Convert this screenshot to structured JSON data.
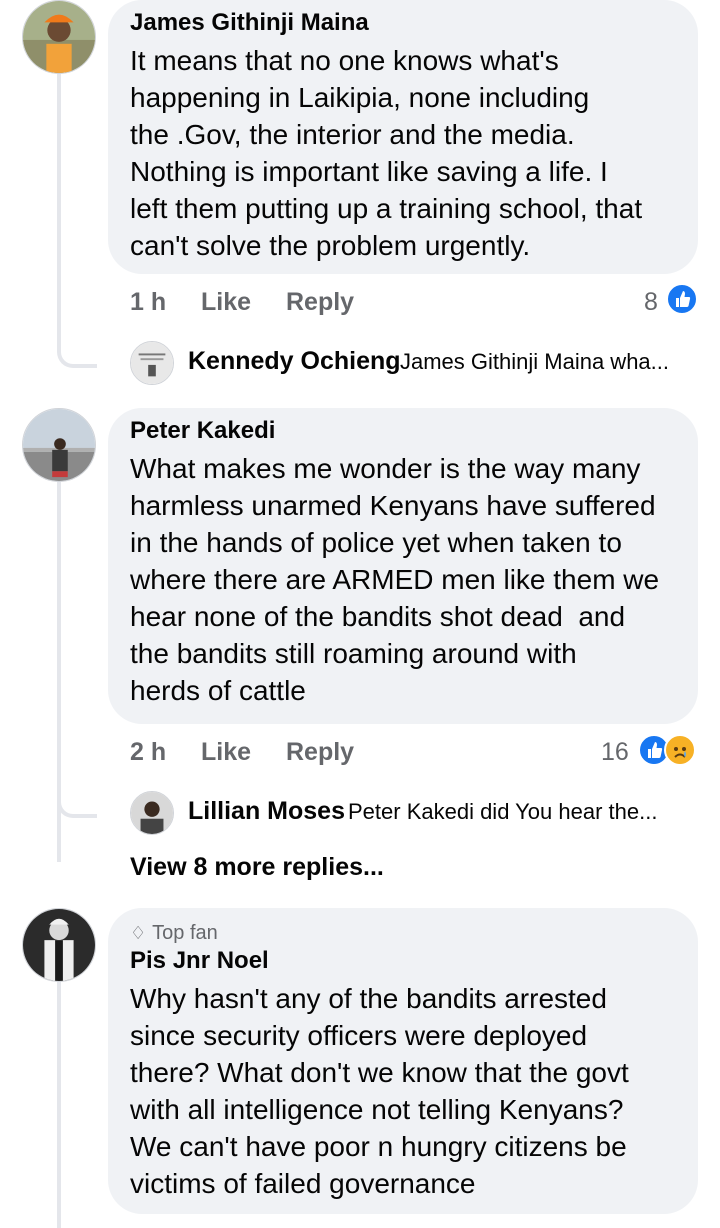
{
  "comments": [
    {
      "author": "James Githinji Maina",
      "text": "It means that no one knows what's\nhappening in Laikipia, none including\nthe .Gov, the interior and the media.\nNothing is important like saving a life. I\nleft them putting up a training school, that\ncan't solve the problem urgently.",
      "time": "1 h",
      "like_label": "Like",
      "reply_label": "Reply",
      "reaction_count": "8",
      "reply_preview": {
        "author": "Kennedy Ochieng",
        "snippet": "James Githinji Maina wha..."
      }
    },
    {
      "author": "Peter Kakedi",
      "text": "What makes me wonder is the way many\nharmless unarmed Kenyans have suffered\nin the hands of police yet when taken to\nwhere there are ARMED men like them we\nhear none of the bandits shot dead  and\nthe bandits still roaming around with\nherds of cattle",
      "time": "2 h",
      "like_label": "Like",
      "reply_label": "Reply",
      "reaction_count": "16",
      "reply_preview": {
        "author": "Lillian Moses",
        "snippet": "Peter Kakedi did You hear the..."
      },
      "more_replies": "View 8 more replies..."
    },
    {
      "badge": "Top fan",
      "author": "Pis Jnr Noel",
      "text": "Why hasn't any of the bandits arrested\nsince security officers were deployed\nthere? What don't we know that the govt\nwith all intelligence not telling Kenyans?\nWe can't have poor n hungry citizens be\nvictims of failed governance"
    }
  ],
  "icons": {
    "like_reaction": "thumbs-up-icon",
    "sad_reaction": "sad-face-icon",
    "top_fan_badge": "diamond-icon"
  },
  "colors": {
    "bubble": "#f0f2f5",
    "secondary_text": "#65676b",
    "like_blue": "#1877f2",
    "sad_yellow": "#f7b125"
  }
}
